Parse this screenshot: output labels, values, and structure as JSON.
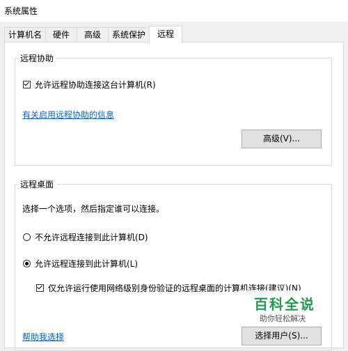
{
  "window": {
    "title": "系统属性"
  },
  "tabs": [
    {
      "label": "计算机名"
    },
    {
      "label": "硬件"
    },
    {
      "label": "高级"
    },
    {
      "label": "系统保护"
    },
    {
      "label": "远程"
    }
  ],
  "remote_assistance": {
    "group_title": "远程协助",
    "allow_checkbox_label": "允许远程协助连接这台计算机(R)",
    "allow_checked": true,
    "info_link": "有关启用远程协助的信息",
    "advanced_button": "高级(V)..."
  },
  "remote_desktop": {
    "group_title": "远程桌面",
    "instruction": "选择一个选项，然后指定谁可以连接。",
    "option_disallow": "不允许远程连接到此计算机(D)",
    "option_allow": "允许远程连接到此计算机(L)",
    "selected_option": "allow",
    "nla_checkbox_label": "仅允许运行使用网络级别身份验证的远程桌面的计算机连接(建议)(N)",
    "nla_checked": true,
    "help_link": "帮助我选择",
    "select_users_button": "选择用户(S)..."
  },
  "watermark": {
    "title": "百科全说",
    "subtitle": "助你轻松解决"
  }
}
